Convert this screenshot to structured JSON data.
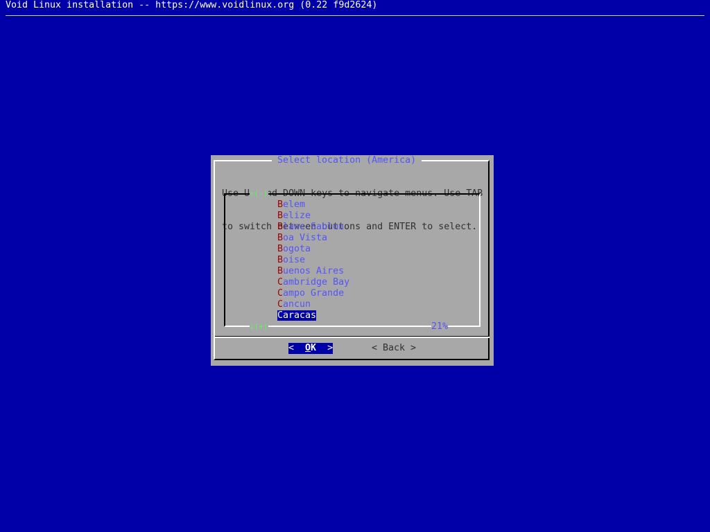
{
  "backtitle": "Void Linux installation -- https://www.voidlinux.org (0.22 f9d2624)",
  "dialog": {
    "title": "Select location (America)",
    "prompt_lines": [
      "Use UP and DOWN keys to navigate menus. Use TAB",
      "to switch between buttons and ENTER to select."
    ],
    "scroll_up": "↑(-)",
    "scroll_down": "↓(+)",
    "percent": "21%",
    "items": [
      {
        "hot": "B",
        "rest": "elem"
      },
      {
        "hot": "B",
        "rest": "elize"
      },
      {
        "hot": "B",
        "rest": "lanc-Sablon"
      },
      {
        "hot": "B",
        "rest": "oa Vista"
      },
      {
        "hot": "B",
        "rest": "ogota"
      },
      {
        "hot": "B",
        "rest": "oise"
      },
      {
        "hot": "B",
        "rest": "uenos Aires"
      },
      {
        "hot": "C",
        "rest": "ambridge Bay"
      },
      {
        "hot": "C",
        "rest": "ampo Grande"
      },
      {
        "hot": "C",
        "rest": "ancun"
      },
      {
        "hot": "C",
        "rest": "aracas"
      }
    ],
    "selected_index": 10,
    "buttons": {
      "ok": {
        "left": "<  ",
        "hot": "O",
        "rest": "K",
        "right": "  >"
      },
      "back": {
        "left": "< ",
        "label": "Back",
        "right": " >"
      }
    }
  },
  "colors": {
    "screen_bg": "#0000a8",
    "dialog_bg": "#a8a8a8",
    "title": "#5454fc",
    "hotkey": "#a80000",
    "scroll_arrow": "#54fc54"
  }
}
